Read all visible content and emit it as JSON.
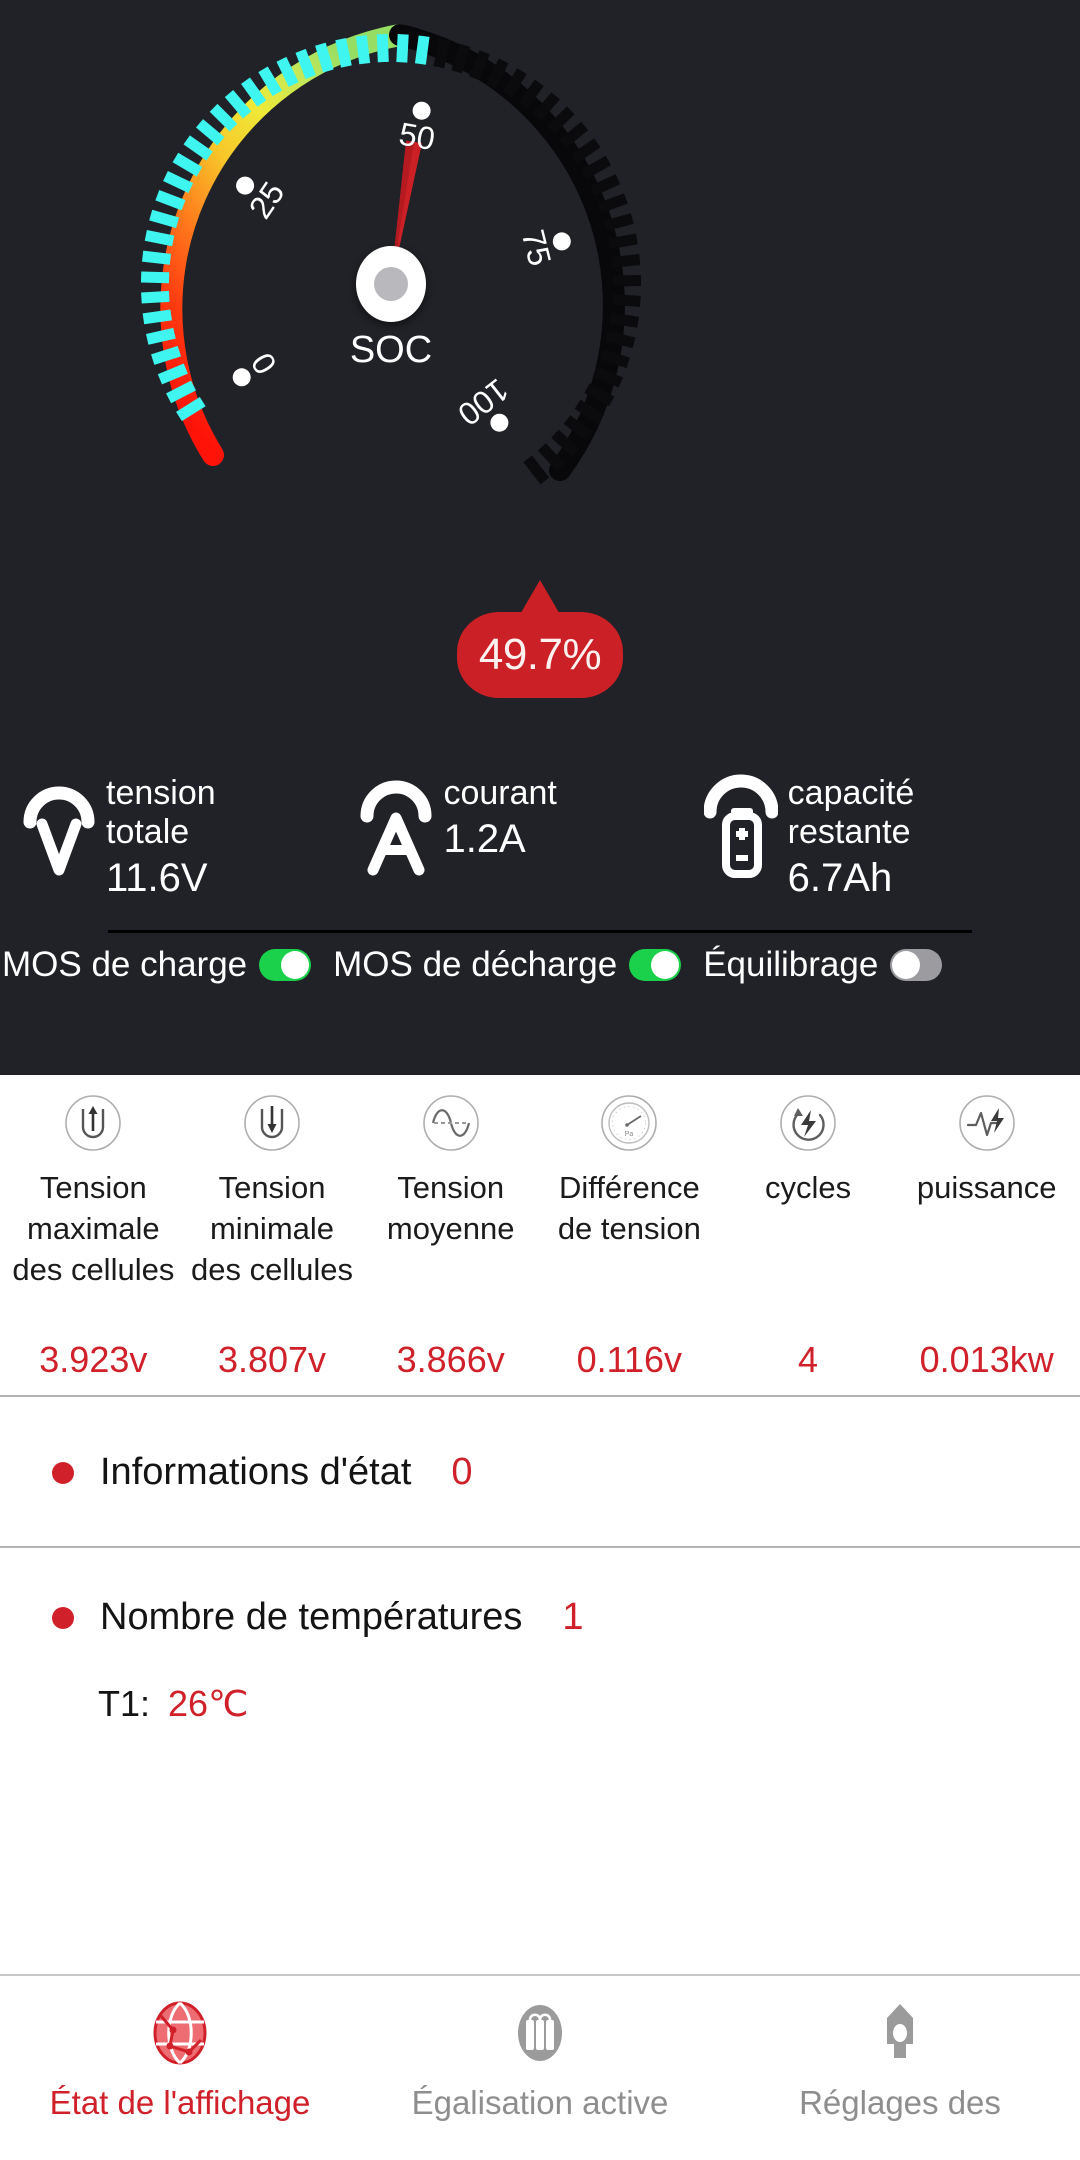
{
  "gauge": {
    "center_label": "SOC",
    "tick_labels": [
      "0",
      "25",
      "50",
      "75",
      "100"
    ],
    "value_badge": "49.7%",
    "soc_value": 49.7,
    "min": 0,
    "max": 100,
    "colors": {
      "panel_bg": "#212227",
      "badge": "#cc2027",
      "needle": "#cc2027",
      "tick_active": "#3ef5ef",
      "tick_inactive": "#0b0b0d",
      "arc_red": "#ff1a14",
      "arc_orange": "#ff8a1e",
      "arc_yellow": "#f5e030",
      "arc_green": "#9fe05c",
      "arc_dark": "#050506"
    }
  },
  "measurements": [
    {
      "icon": "voltmeter-icon",
      "label_line1": "tension",
      "label_line2": "totale",
      "value": "11.6V"
    },
    {
      "icon": "ammeter-icon",
      "label_line1": "courant",
      "label_line2": "",
      "value": "1.2A"
    },
    {
      "icon": "battery-capacity-icon",
      "label_line1": "capacité",
      "label_line2": "restante",
      "value": "6.7Ah"
    }
  ],
  "mos": [
    {
      "label": "MOS de charge",
      "state": "on"
    },
    {
      "label": "MOS de décharge",
      "state": "on"
    },
    {
      "label": "Équilibrage",
      "state": "off"
    }
  ],
  "stats": [
    {
      "icon": "cell-max-icon",
      "name": "Tension maximale des cellules",
      "value": "3.923v"
    },
    {
      "icon": "cell-min-icon",
      "name": "Tension minimale des cellules",
      "value": "3.807v"
    },
    {
      "icon": "sine-wave-icon",
      "name": "Tension moyenne",
      "value": "3.866v"
    },
    {
      "icon": "pressure-gauge-icon",
      "name": "Différence de tension",
      "value": "0.116v"
    },
    {
      "icon": "cycle-bolt-icon",
      "name": "cycles",
      "value": "4"
    },
    {
      "icon": "power-pulse-icon",
      "name": "puissance",
      "value": "0.013kw"
    }
  ],
  "status": {
    "label": "Informations d'état",
    "count": "0"
  },
  "temperature": {
    "label": "Nombre de températures",
    "count": "1",
    "sensors": [
      {
        "key": "T1:",
        "value": "26℃"
      }
    ]
  },
  "bottom_nav": [
    {
      "label": "État de l'affichage",
      "icon": "network-globe-icon",
      "active": true
    },
    {
      "label": "Égalisation active",
      "icon": "battery-cells-icon",
      "active": false
    },
    {
      "label": "Réglages des",
      "icon": "settings-rocket-icon",
      "active": false
    }
  ]
}
